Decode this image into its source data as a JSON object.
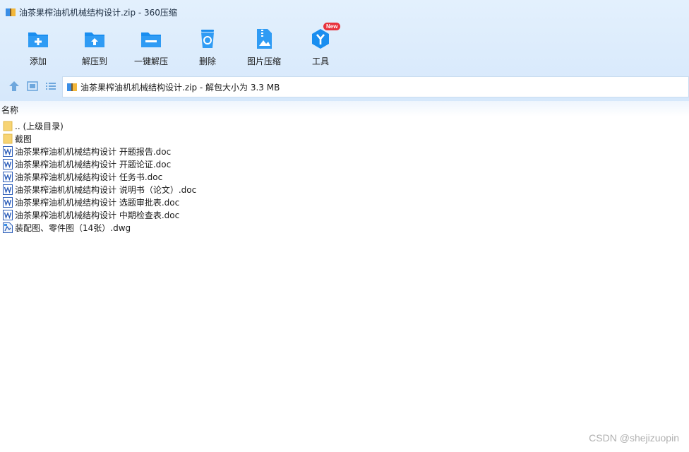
{
  "window": {
    "title": "油茶果榨油机机械结构设计.zip - 360压缩"
  },
  "toolbar": {
    "items": [
      {
        "label": "添加",
        "icon": "add-folder-icon"
      },
      {
        "label": "解压到",
        "icon": "extract-to-icon"
      },
      {
        "label": "一键解压",
        "icon": "one-click-extract-icon"
      },
      {
        "label": "删除",
        "icon": "recycle-bin-icon"
      },
      {
        "label": "图片压缩",
        "icon": "image-compress-icon"
      },
      {
        "label": "工具",
        "icon": "tools-icon",
        "badge": "New"
      }
    ]
  },
  "navbar": {
    "path": "油茶果榨油机机械结构设计.zip - 解包大小为 3.3 MB"
  },
  "list": {
    "column_name": "名称",
    "files": [
      {
        "name": ".. (上级目录)",
        "type": "folder"
      },
      {
        "name": "截图",
        "type": "folder"
      },
      {
        "name": "油茶果榨油机机械结构设计 开题报告.doc",
        "type": "doc"
      },
      {
        "name": "油茶果榨油机机械结构设计 开题论证.doc",
        "type": "doc"
      },
      {
        "name": "油茶果榨油机机械结构设计 任务书.doc",
        "type": "doc"
      },
      {
        "name": "油茶果榨油机机械结构设计 说明书（论文）.doc",
        "type": "doc"
      },
      {
        "name": "油茶果榨油机机械结构设计 选题审批表.doc",
        "type": "doc"
      },
      {
        "name": "油茶果榨油机机械结构设计 中期检查表.doc",
        "type": "doc"
      },
      {
        "name": "装配图、零件图（14张）.dwg",
        "type": "dwg"
      }
    ]
  },
  "watermark": "CSDN @shejizuopin",
  "colors": {
    "accent": "#1a8ef0",
    "top_bg": "#dcebfb",
    "badge": "#e8323c"
  }
}
